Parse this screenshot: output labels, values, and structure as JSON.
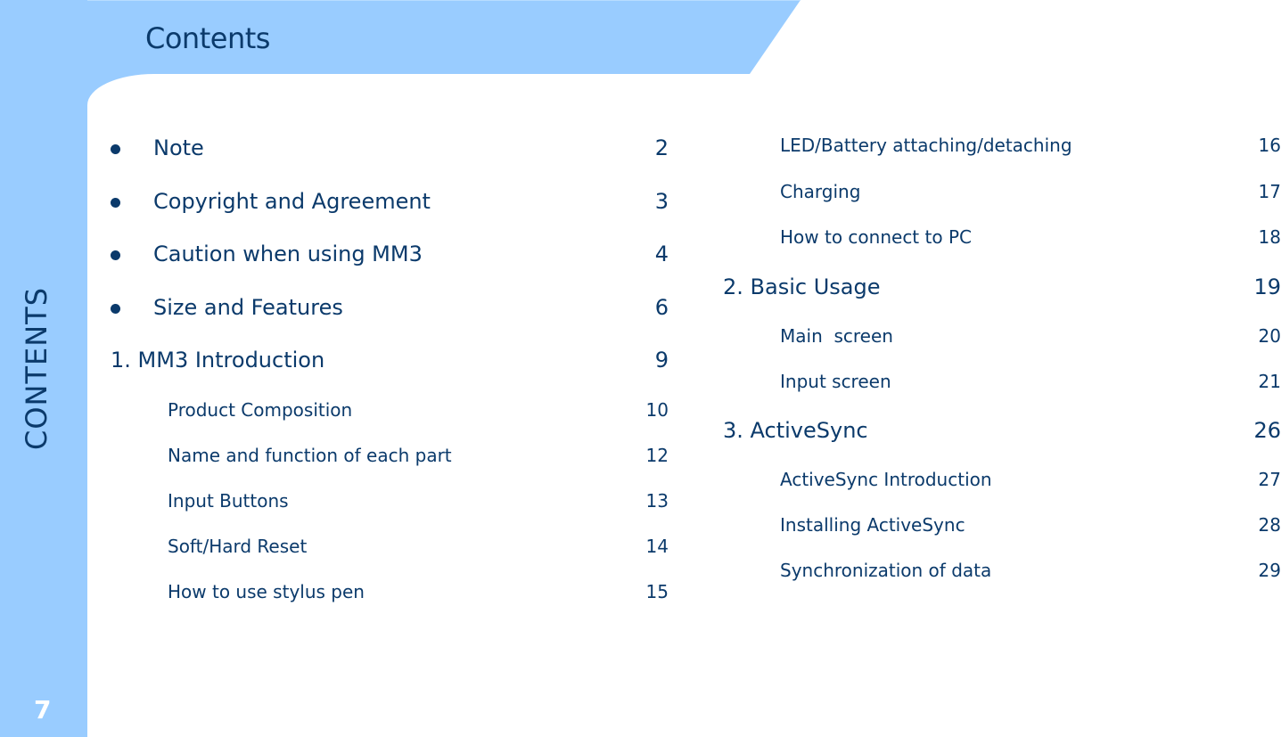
{
  "header": {
    "title": "Contents"
  },
  "sidebar": {
    "vertical_label": "CONTENTS",
    "page_number": "7"
  },
  "colors": {
    "accent": "#99ccff",
    "text": "#0b3a6b"
  },
  "left_column": [
    {
      "label": "Note",
      "page": "2",
      "level": "bullet"
    },
    {
      "label": "Copyright and Agreement",
      "page": "3",
      "level": "bullet"
    },
    {
      "label": "Caution when using MM3",
      "page": "4",
      "level": "bullet"
    },
    {
      "label": "Size and Features",
      "page": "6",
      "level": "bullet"
    },
    {
      "label": "1. MM3 Introduction",
      "page": "9",
      "level": "section"
    },
    {
      "label": "Product Composition",
      "page": "10",
      "level": "sub"
    },
    {
      "label": "Name and function of each part",
      "page": "12",
      "level": "sub"
    },
    {
      "label": "Input Buttons",
      "page": "13",
      "level": "sub"
    },
    {
      "label": "Soft/Hard Reset",
      "page": "14",
      "level": "sub"
    },
    {
      "label": "How to use stylus pen",
      "page": "15",
      "level": "sub"
    }
  ],
  "right_column": [
    {
      "label": "LED/Battery attaching/detaching",
      "page": "16",
      "level": "sub"
    },
    {
      "label": "Charging",
      "page": "17",
      "level": "sub"
    },
    {
      "label": "How to connect to PC",
      "page": "18",
      "level": "sub"
    },
    {
      "label": "2. Basic Usage",
      "page": "19",
      "level": "section"
    },
    {
      "label": "Main  screen",
      "page": "20",
      "level": "sub"
    },
    {
      "label": "Input screen",
      "page": "21",
      "level": "sub"
    },
    {
      "label": "3. ActiveSync",
      "page": "26",
      "level": "section"
    },
    {
      "label": "ActiveSync Introduction",
      "page": "27",
      "level": "sub"
    },
    {
      "label": "Installing ActiveSync",
      "page": "28",
      "level": "sub"
    },
    {
      "label": "Synchronization of data",
      "page": "29",
      "level": "sub"
    }
  ]
}
